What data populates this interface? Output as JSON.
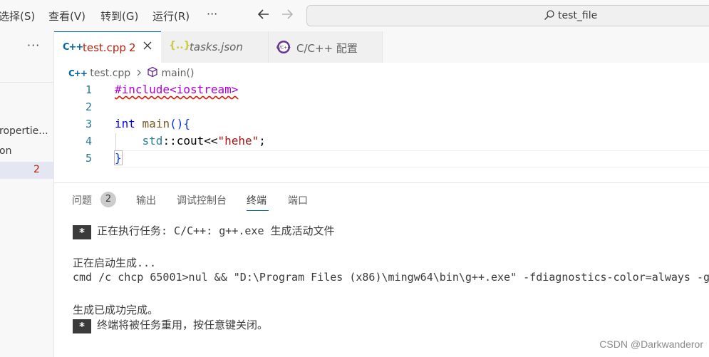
{
  "menu": {
    "select": "选择(S)",
    "view": "查看(V)",
    "goto": "转到(G)",
    "run": "运行(R)",
    "more": "···"
  },
  "search": {
    "text": "test_file"
  },
  "sidebar": {
    "more": "···",
    "items": [
      {
        "label": "ropertie..."
      },
      {
        "label": "on"
      },
      {
        "label": "",
        "count": "2"
      }
    ]
  },
  "tabs": [
    {
      "icon": "cpp-file-icon",
      "label": "test.cpp",
      "count": "2",
      "active": true
    },
    {
      "icon": "json-file-icon",
      "label": "tasks.json",
      "active": false
    },
    {
      "icon": "cpp-config-icon",
      "label": "C/C++ 配置",
      "active": false
    }
  ],
  "breadcrumb": {
    "file": "test.cpp",
    "symbol": "main()"
  },
  "editor": {
    "line_numbers": [
      "1",
      "2",
      "3",
      "4",
      "5"
    ],
    "code": {
      "include": "#include<iostream>",
      "int_kw": "int",
      "main_fn": "main",
      "main_rest": "(){",
      "std_ns": "std",
      "scope": "::",
      "cout": "cout<<",
      "str": "\"hehe\"",
      "semi": ";",
      "close": "}"
    }
  },
  "panel": {
    "tabs": [
      {
        "label": "问题",
        "badge": "2"
      },
      {
        "label": "输出"
      },
      {
        "label": "调试控制台"
      },
      {
        "label": "终端",
        "active": true
      },
      {
        "label": "端口"
      }
    ],
    "terminal": {
      "star": "*",
      "task_line": "正在执行任务: C/C++: g++.exe 生成活动文件",
      "starting": "正在启动生成...",
      "command": "cmd /c chcp 65001>nul && \"D:\\Program Files (x86)\\mingw64\\bin\\g++.exe\" -fdiagnostics-color=always -g",
      "success": "生成已成功完成。",
      "reuse": "终端将被任务重用，按任意键关闭。"
    }
  },
  "watermark": "CSDN @Darkwanderor",
  "colors": {
    "accent": "#005fb8",
    "error": "#e51400",
    "keyword": "#0000ff",
    "string": "#a31515"
  }
}
